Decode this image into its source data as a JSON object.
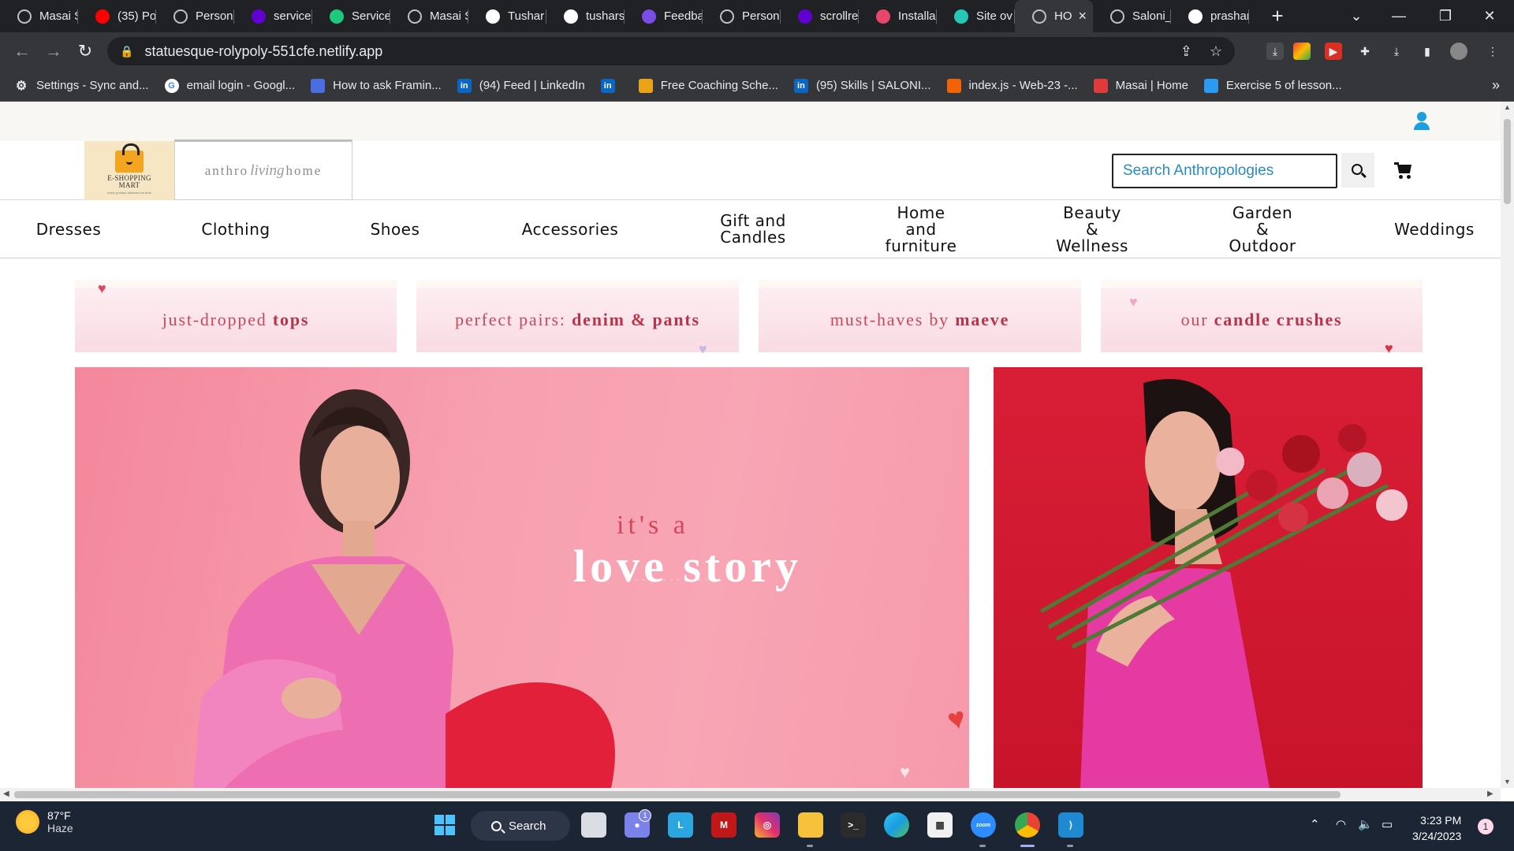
{
  "browser": {
    "tabs": [
      {
        "label": "Masai S",
        "icon": "globe-icon",
        "color": "#5f6368"
      },
      {
        "label": "(35) Po",
        "icon": "youtube-icon",
        "color": "#ff0000"
      },
      {
        "label": "Persona",
        "icon": "globe-icon",
        "color": "#5f6368"
      },
      {
        "label": "service",
        "icon": "yahoo-icon",
        "color": "#6001d2"
      },
      {
        "label": "Service",
        "icon": "vuetify-icon",
        "color": "#1ec97a"
      },
      {
        "label": "Masai S",
        "icon": "globe-icon",
        "color": "#5f6368"
      },
      {
        "label": "Tushar",
        "icon": "vercel-icon",
        "color": "#ffffff"
      },
      {
        "label": "tushars",
        "icon": "github-icon",
        "color": "#ffffff"
      },
      {
        "label": "Feedba",
        "icon": "form-icon",
        "color": "#7a4ee6"
      },
      {
        "label": "Person",
        "icon": "globe-icon",
        "color": "#5f6368"
      },
      {
        "label": "scrollre",
        "icon": "yahoo-icon",
        "color": "#6001d2"
      },
      {
        "label": "Installa",
        "icon": "bars-icon",
        "color": "#e8456b"
      },
      {
        "label": "Site ov",
        "icon": "netlify-icon",
        "color": "#25c7b7"
      },
      {
        "label": "HO",
        "icon": "globe-icon",
        "color": "#5f6368",
        "active": true
      },
      {
        "label": "Saloni_",
        "icon": "globe-icon",
        "color": "#5f6368"
      },
      {
        "label": "prashar",
        "icon": "github-icon",
        "color": "#ffffff"
      }
    ],
    "url": "statuesque-rolypoly-551cfe.netlify.app",
    "bookmarks": [
      {
        "label": "Settings - Sync and...",
        "icon": "gear-icon",
        "color": "#9aa0a6"
      },
      {
        "label": "email login - Googl...",
        "icon": "google-icon",
        "color": "#ffffff"
      },
      {
        "label": "How to ask Framin...",
        "icon": "translate-icon",
        "color": "#4a6ee0"
      },
      {
        "label": "(94) Feed | LinkedIn",
        "icon": "linkedin-icon",
        "color": "#0a66c2"
      },
      {
        "label": "",
        "icon": "linkedin-icon",
        "color": "#0a66c2"
      },
      {
        "label": "Free Coaching Sche...",
        "icon": "trophy-icon",
        "color": "#e8a317"
      },
      {
        "label": "(95) Skills | SALONI...",
        "icon": "linkedin-icon",
        "color": "#0a66c2"
      },
      {
        "label": "index.js - Web-23 -...",
        "icon": "replit-icon",
        "color": "#f26207"
      },
      {
        "label": "Masai | Home",
        "icon": "masai-icon",
        "color": "#e03a3a"
      },
      {
        "label": "Exercise 5 of lesson...",
        "icon": "exercise-icon",
        "color": "#2b9af3"
      }
    ],
    "more_bookmarks": "»"
  },
  "site": {
    "logo_shop": {
      "title_line1": "E-SHOPPING",
      "title_line2": "MART",
      "tagline": "every product delivered on time"
    },
    "logo_anthro": {
      "left": "anthro",
      "script": "living",
      "right": "home"
    },
    "search_placeholder": "Search Anthropologies",
    "nav": [
      {
        "label": "Dresses"
      },
      {
        "label": "Clothing"
      },
      {
        "label": "Shoes"
      },
      {
        "label": "Accessories"
      },
      {
        "label": "Gift and\nCandles"
      },
      {
        "label": "Home\nand\nfurniture"
      },
      {
        "label": "Beauty\n&\nWellness"
      },
      {
        "label": "Garden\n&\nOutdoor"
      },
      {
        "label": "Weddings"
      }
    ],
    "promos": [
      {
        "light": "just-dropped",
        "bold": "tops"
      },
      {
        "light": "perfect pairs:",
        "bold": "denim & pants"
      },
      {
        "light": "must-haves by",
        "bold": "maeve"
      },
      {
        "light": "our",
        "bold": "candle crushes"
      }
    ],
    "hero": {
      "kicker": "it's a",
      "title": "love story",
      "dots": "..............",
      "accent_pink": "#f7a0b0",
      "accent_red": "#d81e36"
    }
  },
  "taskbar": {
    "weather_temp": "87°F",
    "weather_desc": "Haze",
    "search_label": "Search",
    "chat_badge": "1",
    "time": "3:23 PM",
    "date": "3/24/2023",
    "notifications": "1"
  }
}
